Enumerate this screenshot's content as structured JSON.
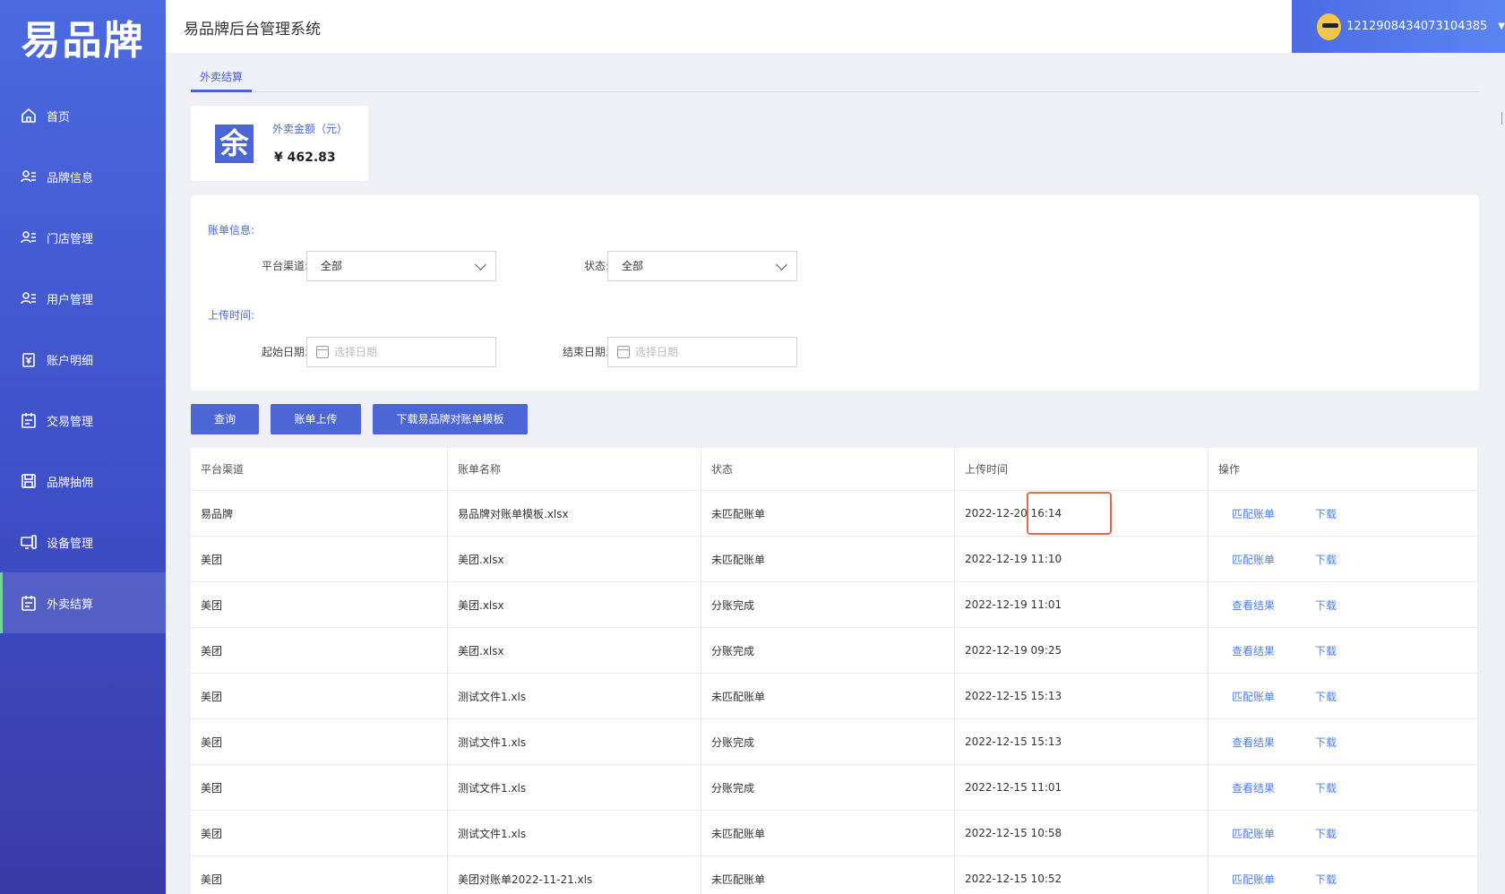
{
  "logo": "易品牌",
  "sidebar": {
    "items": [
      {
        "label": "首页",
        "icon": "home-icon"
      },
      {
        "label": "品牌信息",
        "icon": "user-list-icon"
      },
      {
        "label": "门店管理",
        "icon": "user-list-icon"
      },
      {
        "label": "用户管理",
        "icon": "user-list-icon"
      },
      {
        "label": "账户明细",
        "icon": "wallet-icon"
      },
      {
        "label": "交易管理",
        "icon": "clipboard-icon"
      },
      {
        "label": "品牌抽佣",
        "icon": "save-icon"
      },
      {
        "label": "设备管理",
        "icon": "device-icon"
      },
      {
        "label": "外卖结算",
        "icon": "clipboard-icon"
      }
    ],
    "active_index": 8,
    "accent_color": "#6fd3a3"
  },
  "header": {
    "title": "易品牌后台管理系统",
    "username": "1212908434073104385"
  },
  "tabs": [
    {
      "label": "外卖结算"
    }
  ],
  "summary": {
    "icon_char": "余",
    "label": "外卖金额（元）",
    "value": "¥ 462.83"
  },
  "filters": {
    "bill_info_title": "账单信息:",
    "channel_label": "平台渠道:",
    "channel_value": "全部",
    "status_label": "状态:",
    "status_value": "全部",
    "upload_time_title": "上传时间:",
    "start_label": "起始日期:",
    "start_placeholder": "选择日期",
    "end_label": "结束日期:",
    "end_placeholder": "选择日期"
  },
  "buttons": {
    "query": "查询",
    "upload": "账单上传",
    "download_template": "下载易品牌对账单模板"
  },
  "table": {
    "headers": [
      "平台渠道",
      "账单名称",
      "状态",
      "上传时间",
      "操作"
    ],
    "rows": [
      {
        "channel": "易品牌",
        "name": "易品牌对账单模板.xlsx",
        "status": "未匹配账单",
        "time": "2022-12-20 16:14",
        "action": "匹配账单",
        "download": "下载"
      },
      {
        "channel": "美团",
        "name": "美团.xlsx",
        "status": "未匹配账单",
        "time": "2022-12-19 11:10",
        "action": "匹配账单",
        "download": "下载"
      },
      {
        "channel": "美团",
        "name": "美团.xlsx",
        "status": "分账完成",
        "time": "2022-12-19 11:01",
        "action": "查看结果",
        "download": "下载"
      },
      {
        "channel": "美团",
        "name": "美团.xlsx",
        "status": "分账完成",
        "time": "2022-12-19 09:25",
        "action": "查看结果",
        "download": "下载"
      },
      {
        "channel": "美团",
        "name": "测试文件1.xls",
        "status": "未匹配账单",
        "time": "2022-12-15 15:13",
        "action": "匹配账单",
        "download": "下载"
      },
      {
        "channel": "美团",
        "name": "测试文件1.xls",
        "status": "分账完成",
        "time": "2022-12-15 15:13",
        "action": "查看结果",
        "download": "下载"
      },
      {
        "channel": "美团",
        "name": "测试文件1.xls",
        "status": "分账完成",
        "time": "2022-12-15 11:01",
        "action": "查看结果",
        "download": "下载"
      },
      {
        "channel": "美团",
        "name": "测试文件1.xls",
        "status": "未匹配账单",
        "time": "2022-12-15 10:58",
        "action": "匹配账单",
        "download": "下载"
      },
      {
        "channel": "美团",
        "name": "美团对账单2022-11-21.xls",
        "status": "未匹配账单",
        "time": "2022-12-15 10:52",
        "action": "匹配账单",
        "download": "下载"
      }
    ]
  },
  "colors": {
    "primary": "#4c66d6",
    "link": "#4d7ef2",
    "highlight_border": "#e36b4d"
  }
}
